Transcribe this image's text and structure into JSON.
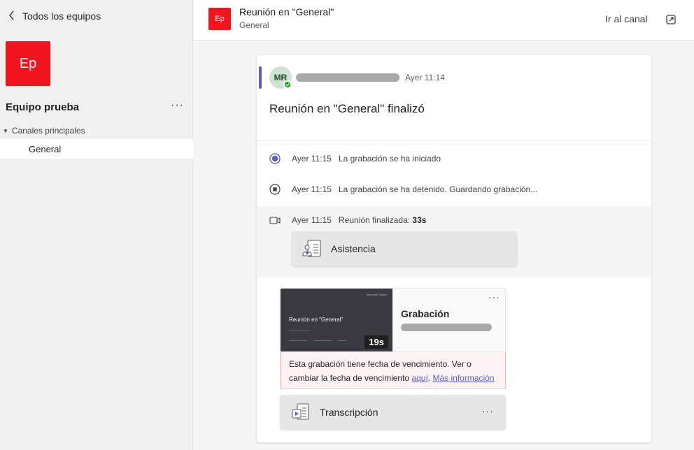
{
  "sidebar": {
    "back_label": "Todos los equipos",
    "team_initials": "Ep",
    "team_name": "Equipo prueba",
    "team_more": "···",
    "section_label": "Canales principales",
    "channel": "General"
  },
  "header": {
    "initials": "Ep",
    "title": "Reunión en \"General\"",
    "subtitle": "General",
    "go_to_channel": "Ir al canal"
  },
  "message": {
    "avatar_initials": "MR",
    "time": "Ayer 11:14",
    "title": "Reunión en \"General\" finalizó"
  },
  "events": [
    {
      "icon": "recording-started-icon",
      "time": "Ayer 11:15",
      "text": "La grabación se ha iniciado"
    },
    {
      "icon": "recording-stopped-icon",
      "time": "Ayer 11:15",
      "text": "La grabación se ha detenido. Guardando grabación..."
    },
    {
      "icon": "video-camera-icon",
      "time": "Ayer 11:15",
      "text": "Reunión finalizada:",
      "bold": "33s"
    }
  ],
  "attendance_label": "Asistencia",
  "recording": {
    "thumb_brand": "Microsoft Teams",
    "thumb_title": "Reunión en \"General\"",
    "duration": "19s",
    "title": "Grabación",
    "more": "···"
  },
  "expiry": {
    "text": "Esta grabación tiene fecha de vencimiento. Ver o cambiar la fecha de vencimiento",
    "link_here": "aquí",
    "sep": ".",
    "link_more": "Más información"
  },
  "transcript": {
    "label": "Transcripción",
    "more": "···"
  },
  "colors": {
    "team_tile": "#f0141e",
    "accent": "#5b5fc7",
    "presence": "#13a10e"
  }
}
